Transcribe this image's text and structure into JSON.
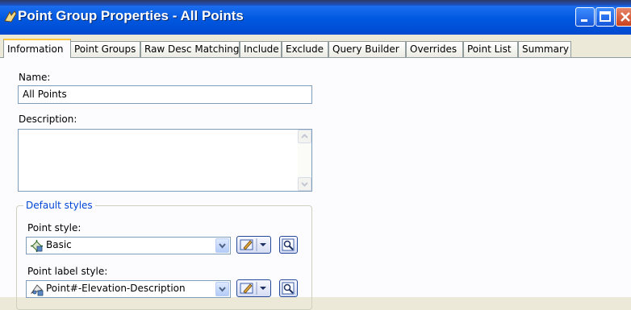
{
  "window": {
    "title": "Point Group Properties - All Points"
  },
  "tabs": [
    {
      "label": "Information"
    },
    {
      "label": "Point Groups"
    },
    {
      "label": "Raw Desc Matching"
    },
    {
      "label": "Include"
    },
    {
      "label": "Exclude"
    },
    {
      "label": "Query Builder"
    },
    {
      "label": "Overrides"
    },
    {
      "label": "Point List"
    },
    {
      "label": "Summary"
    }
  ],
  "form": {
    "name_label": "Name:",
    "name_value": "All Points",
    "description_label": "Description:",
    "description_value": "",
    "default_styles_legend": "Default styles",
    "point_style_label": "Point style:",
    "point_style_value": "Basic",
    "point_label_style_label": "Point label style:",
    "point_label_style_value": "Point#-Elevation-Description"
  },
  "colors": {
    "titlebar": "#0058e0",
    "active_tab_highlight": "#ffc83c",
    "groupbox_legend": "#0046d5"
  }
}
